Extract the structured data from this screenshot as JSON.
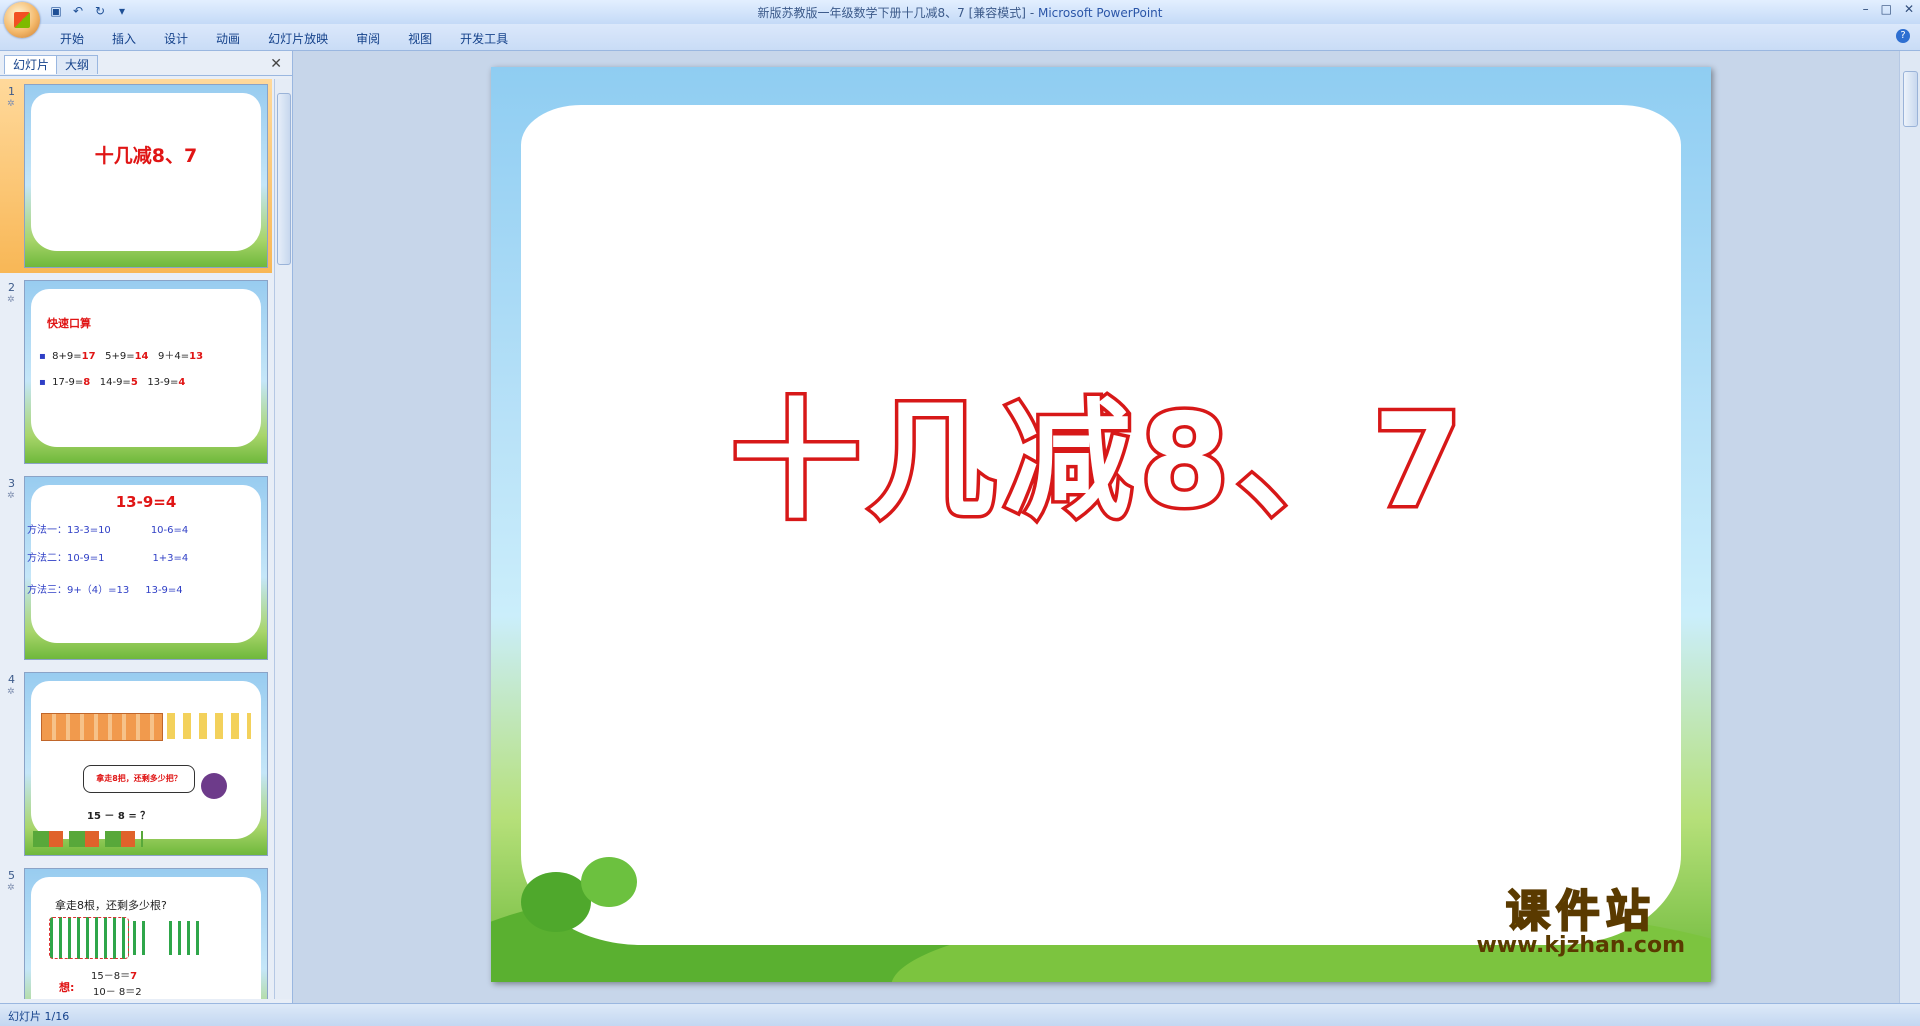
{
  "window": {
    "title": "新版苏教版一年级数学下册十几减8、7 [兼容模式]",
    "app_name": "Microsoft PowerPoint"
  },
  "quick_access": {
    "icons": [
      "save-icon",
      "undo-icon",
      "redo-icon",
      "customize-icon"
    ]
  },
  "ribbon": {
    "tabs": [
      "开始",
      "插入",
      "设计",
      "动画",
      "幻灯片放映",
      "审阅",
      "视图",
      "开发工具"
    ]
  },
  "left_pane": {
    "tabs": [
      "幻灯片",
      "大纲"
    ],
    "active_tab": "幻灯片"
  },
  "thumbnails": [
    {
      "number": "1",
      "title": "十几减8、7"
    },
    {
      "number": "2",
      "heading": "快速口算",
      "row1": {
        "items": [
          "8+9=",
          "17",
          "5+9=",
          "14",
          "9＋4=",
          "13"
        ]
      },
      "row2": {
        "items": [
          "17-9=",
          "8",
          "14-9=",
          "5",
          "13-9=",
          "4"
        ]
      }
    },
    {
      "number": "3",
      "heading": "13-9=4",
      "lines": [
        {
          "label": "方法一：",
          "a": "13-3=10",
          "b": "10-6=4"
        },
        {
          "label": "方法二：",
          "a": "10-9=1",
          "b": "1+3=4"
        },
        {
          "label": "方法三：",
          "a": "9+（4）=13",
          "b": "13-9=4"
        }
      ]
    },
    {
      "number": "4",
      "bubble": "拿走8把，还剩多少把？",
      "equation": "15 － 8 = ？"
    },
    {
      "number": "5",
      "question": "拿走8根，还剩多少根?",
      "think_label": "想:",
      "eq1": "15－8＝",
      "eq1_answer": "7",
      "eq2": "10－ 8＝2"
    }
  ],
  "slide": {
    "title": "十几减8、7"
  },
  "watermark": {
    "brand": "课件站",
    "url": "www.kjzhan.com"
  },
  "status_bar": {
    "text": "幻灯片 1/16"
  }
}
